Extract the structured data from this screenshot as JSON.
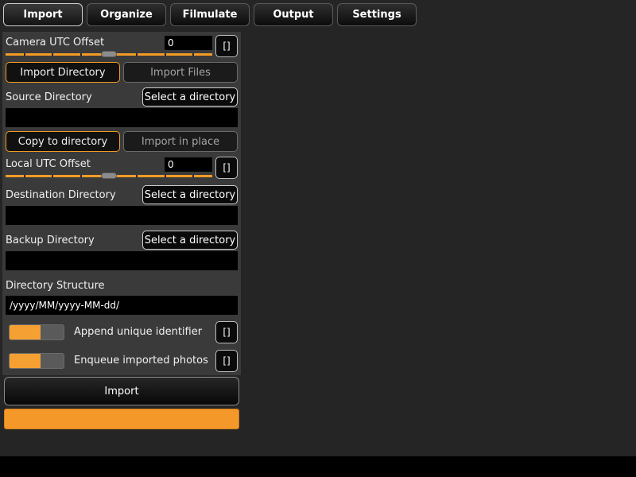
{
  "tabs": [
    {
      "label": "Import",
      "active": true
    },
    {
      "label": "Organize",
      "active": false
    },
    {
      "label": "Filmulate",
      "active": false
    },
    {
      "label": "Output",
      "active": false
    },
    {
      "label": "Settings",
      "active": false
    }
  ],
  "camera_utc": {
    "label": "Camera UTC Offset",
    "value": "0",
    "reset_label": "[]",
    "slider_level": 0.5
  },
  "import_mode": {
    "directory_label": "Import Directory",
    "files_label": "Import Files",
    "selected": "directory"
  },
  "source_directory": {
    "label": "Source Directory",
    "select_label": "Select a directory",
    "value": ""
  },
  "copy_mode": {
    "copy_label": "Copy to directory",
    "inplace_label": "Import in place",
    "selected": "copy"
  },
  "local_utc": {
    "label": "Local UTC Offset",
    "value": "0",
    "reset_label": "[]",
    "slider_level": 0.5
  },
  "destination_directory": {
    "label": "Destination Directory",
    "select_label": "Select a directory",
    "value": ""
  },
  "backup_directory": {
    "label": "Backup Directory",
    "select_label": "Select a directory",
    "value": ""
  },
  "directory_structure": {
    "label": "Directory Structure",
    "value": "/yyyy/MM/yyyy-MM-dd/"
  },
  "append_identifier": {
    "label": "Append unique identifier",
    "reset_label": "[]",
    "enabled": true
  },
  "enqueue_photos": {
    "label": "Enqueue imported photos",
    "reset_label": "[]",
    "enabled": true
  },
  "import_button": {
    "label": "Import"
  },
  "progress": {
    "level": 1.0
  },
  "colors": {
    "accent": "#f29b26",
    "panel": "#3a3a3a",
    "background": "#252525"
  }
}
